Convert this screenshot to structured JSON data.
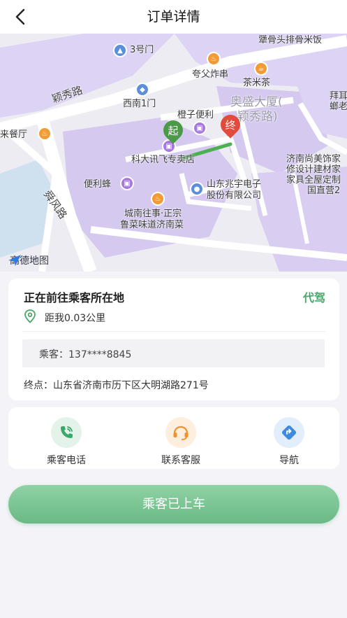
{
  "header": {
    "title": "订单详情"
  },
  "map": {
    "labels": {
      "l1": "犟骨头排骨米饭",
      "l2": "3号门",
      "l3": "夸父炸串",
      "l4": "茶米茶",
      "l5": "颖秀路",
      "l6": "西南1门",
      "l7a": "奥盛大厦(",
      "l7b": "颖秀路)",
      "l8": "橙子便利",
      "l9": "来餐厅",
      "l10": "科大讯飞专卖店",
      "l11a": "济南尚美饰家",
      "l11b": "修设计建材家",
      "l11c": "家具全屋定制",
      "l11d": "国直营2",
      "l12a": "拜耳",
      "l12b": "螂老",
      "l13": "便利蜂",
      "l14a": "山东兆宇电子",
      "l14b": "股份有限公司",
      "l15": "舜风路",
      "l16a": "城南往事·正宗",
      "l16b": "鲁菜味道济南菜"
    },
    "start_marker": "起",
    "end_marker": "终",
    "logo": "高德地图",
    "colors": {
      "block": "#d9cdf2",
      "road": "#ffffff",
      "route": "#4caf50",
      "start": "#4a9a48",
      "end": "#e24a3b",
      "water": "#cfe0ef"
    }
  },
  "order": {
    "status": "正在前往乘客所在地",
    "badge": "代驾",
    "distance": "距我0.03公里",
    "passenger": "乘客：137****8845",
    "destination": "终点：山东省济南市历下区大明湖路271号"
  },
  "actions": [
    {
      "label": "乘客电话",
      "icon": "phone-icon",
      "color": "#3aa868"
    },
    {
      "label": "联系客服",
      "icon": "headset-icon",
      "color": "#f0922a"
    },
    {
      "label": "导航",
      "icon": "navigation-icon",
      "color": "#3d8ae0"
    }
  ],
  "primary_button": {
    "label": "乘客已上车"
  }
}
